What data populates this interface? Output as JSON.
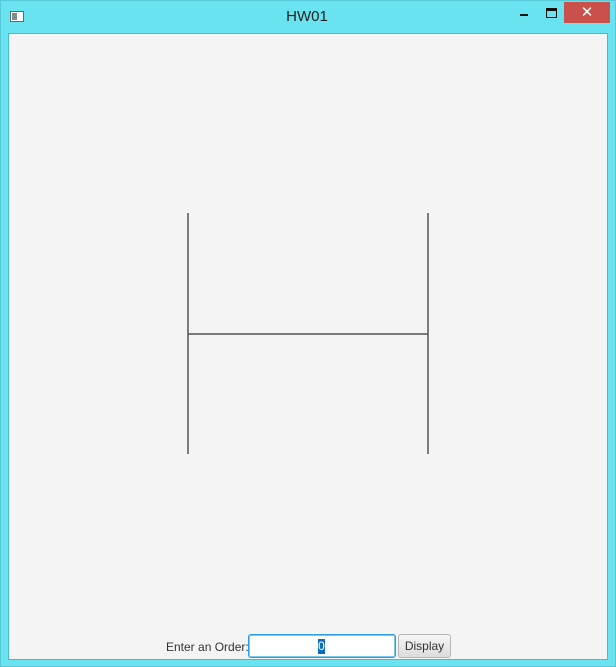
{
  "window": {
    "title": "HW01",
    "icons": {
      "app": "window-icon",
      "minimize": "minimize-icon",
      "maximize": "maximize-icon",
      "close": "close-icon"
    },
    "close_glyph": "✕"
  },
  "controls": {
    "label": "Enter an Order:",
    "input_value": "0",
    "button_label": "Display"
  },
  "drawing": {
    "order": 0,
    "shape": "H",
    "color": "#555555"
  }
}
